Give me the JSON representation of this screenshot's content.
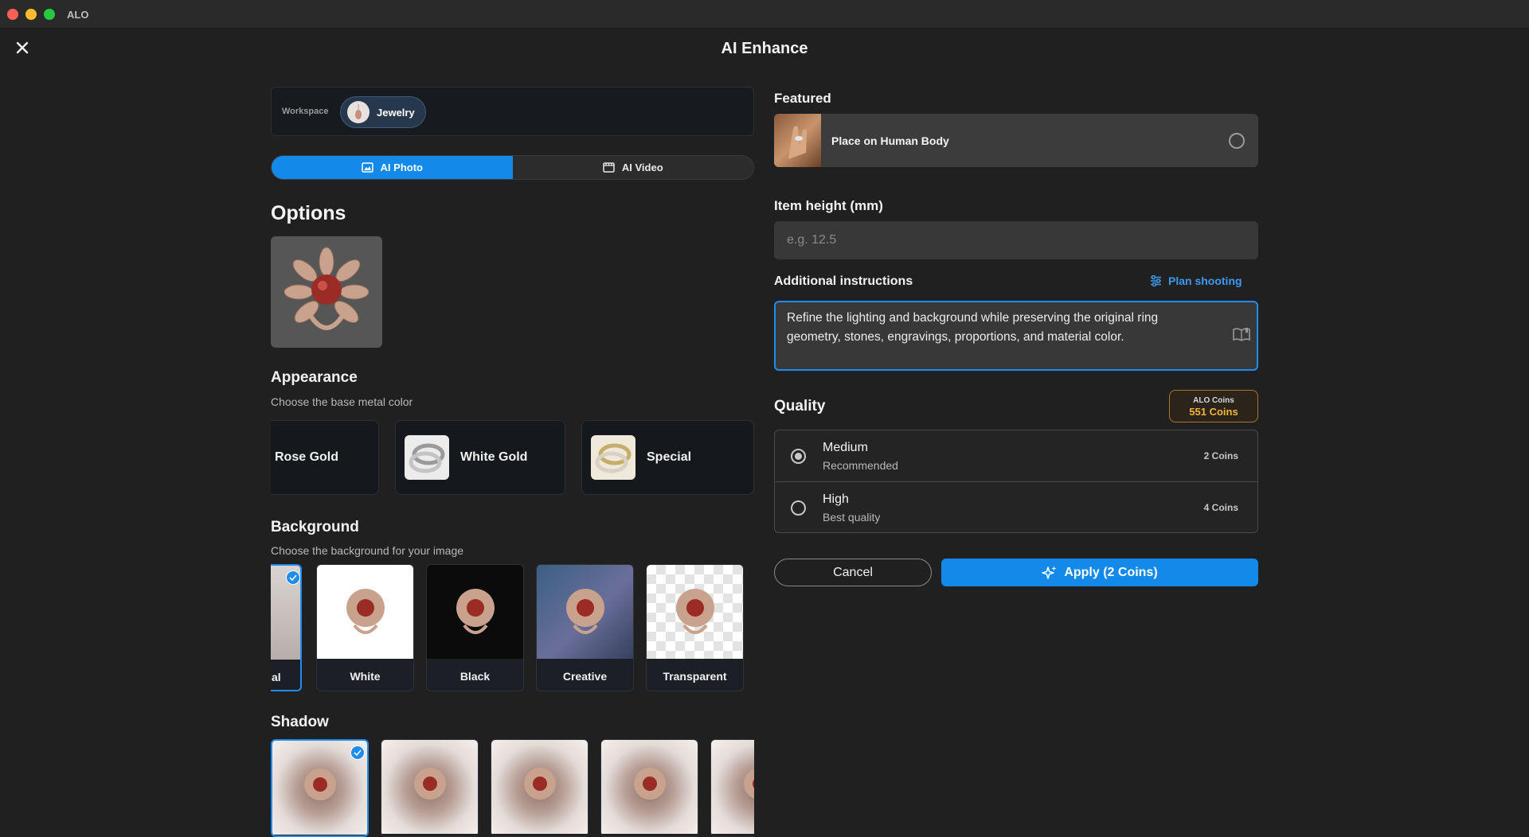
{
  "window": {
    "app_name": "ALO"
  },
  "header": {
    "title": "AI Enhance",
    "close_icon": "close-icon"
  },
  "workspace": {
    "label": "Workspace",
    "chip_label": "Jewelry"
  },
  "mode_tabs": [
    {
      "label": "AI Photo",
      "icon": "image-icon",
      "active": true
    },
    {
      "label": "AI Video",
      "icon": "film-icon",
      "active": false
    }
  ],
  "options": {
    "title": "Options"
  },
  "appearance": {
    "title": "Appearance",
    "subtitle": "Choose the base metal color",
    "items": [
      {
        "label": "Rose Gold"
      },
      {
        "label": "White Gold"
      },
      {
        "label": "Special"
      }
    ]
  },
  "background": {
    "title": "Background",
    "subtitle": "Choose the background for your image",
    "items": [
      {
        "label": "al",
        "selected": true
      },
      {
        "label": "White",
        "selected": false
      },
      {
        "label": "Black",
        "selected": false
      },
      {
        "label": "Creative",
        "selected": false
      },
      {
        "label": "Transparent",
        "selected": false
      }
    ]
  },
  "shadow": {
    "title": "Shadow",
    "selected_index": 0
  },
  "featured": {
    "title": "Featured",
    "item_label": "Place on Human Body"
  },
  "item_height": {
    "label": "Item height (mm)",
    "placeholder": "e.g. 12.5",
    "value": ""
  },
  "instructions": {
    "label": "Additional instructions",
    "plan_link": "Plan shooting",
    "text": "Refine the lighting and background while preserving the original ring geometry, stones, engravings, proportions, and material color."
  },
  "quality": {
    "title": "Quality",
    "coins_badge": {
      "title": "ALO Coins",
      "value": "551 Coins"
    },
    "options": [
      {
        "title": "Medium",
        "subtitle": "Recommended",
        "cost": "2 Coins",
        "selected": true
      },
      {
        "title": "High",
        "subtitle": "Best quality",
        "cost": "4 Coins",
        "selected": false
      }
    ]
  },
  "actions": {
    "cancel_label": "Cancel",
    "apply_label": "Apply (2 Coins)"
  },
  "colors": {
    "accent": "#1389ea",
    "coins": "#f2b43c",
    "background": "#202020"
  }
}
